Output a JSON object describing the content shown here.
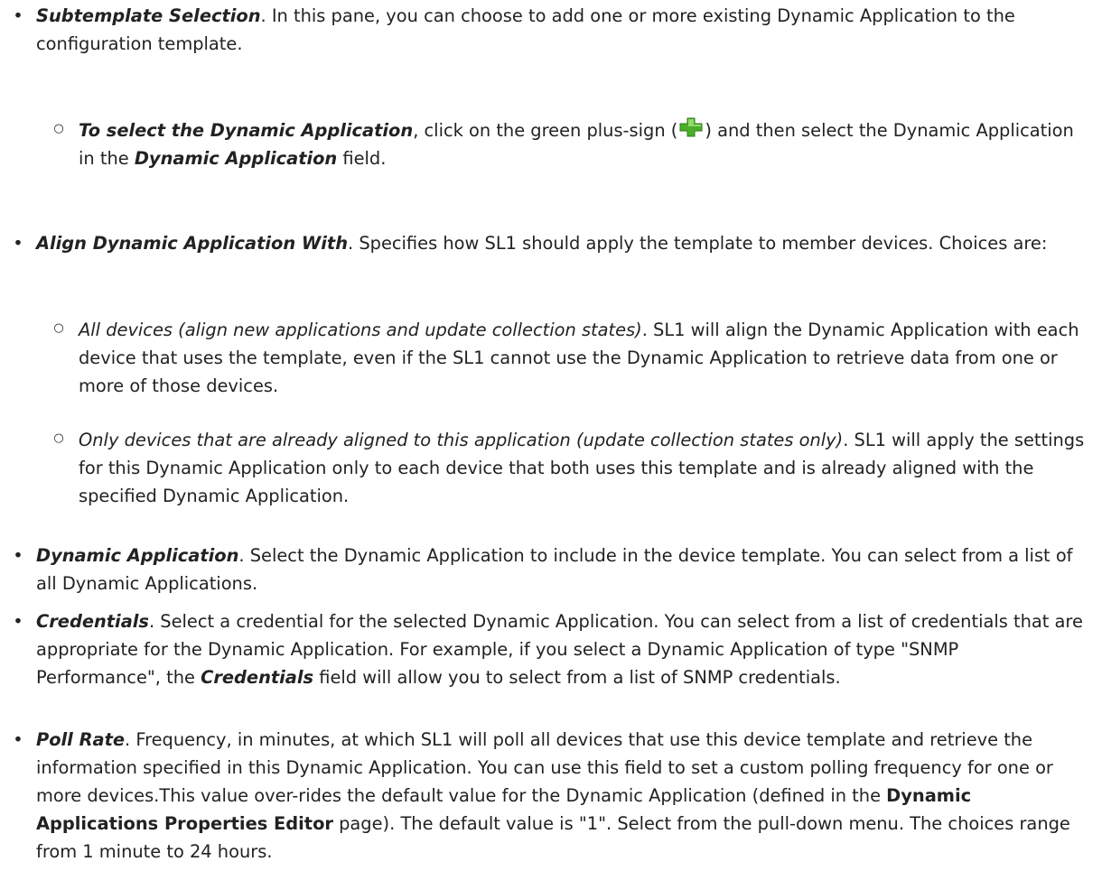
{
  "colors": {
    "text": "#222222",
    "plus_green": "#4cae2c",
    "plus_green_dark": "#2d7a16"
  },
  "items": {
    "subtemplate": {
      "term": "Subtemplate Selection",
      "text": ". In this pane, you can choose to add one or more existing Dynamic Application to the configuration template."
    },
    "select_da": {
      "term": "To select the Dynamic Application",
      "text1": ", click on the green plus-sign (",
      "icon": "green-plus-icon",
      "text2": ") and then select the Dynamic Application in the ",
      "field": "Dynamic Application",
      "text3": " field."
    },
    "align": {
      "term": "Align Dynamic Application With",
      "text": ". Specifies how SL1 should apply the template to member devices. Choices are:"
    },
    "all_devices": {
      "option": "All devices (align new applications and update collection states)",
      "text": ". SL1 will align the Dynamic Application with each device that uses the template, even if the SL1 cannot use the Dynamic Application to retrieve data from one or more of those devices."
    },
    "only_devices": {
      "option": "Only devices that are already aligned to this application (update collection states only)",
      "text": ". SL1 will apply the settings for this Dynamic Application only to each device that both uses this template and is already aligned with the specified Dynamic Application."
    },
    "dynamic_app": {
      "term": "Dynamic Application",
      "text": ". Select the Dynamic Application to include in the device template. You can select from a list of all Dynamic Applications."
    },
    "credentials": {
      "term": "Credentials",
      "text1": ". Select a credential for the selected Dynamic Application. You can select from a list of credentials that are appropriate for the Dynamic Application. For example, if you select a Dynamic Application of type \"SNMP Performance\", the ",
      "field": "Credentials",
      "text2": " field will allow you to select from a list of SNMP credentials."
    },
    "poll_rate": {
      "term": "Poll Rate",
      "text1": ". Frequency, in minutes, at which SL1 will poll all devices that use this device template and retrieve the information specified in this Dynamic Application. You can use this field to set a custom polling frequency for one or more devices.This value over-rides the default value for the Dynamic Application (defined in the ",
      "page": "Dynamic Applications Properties Editor",
      "text2": " page). The default value is \"1\". Select from the pull-down menu. The choices range from 1 minute to 24 hours."
    }
  }
}
